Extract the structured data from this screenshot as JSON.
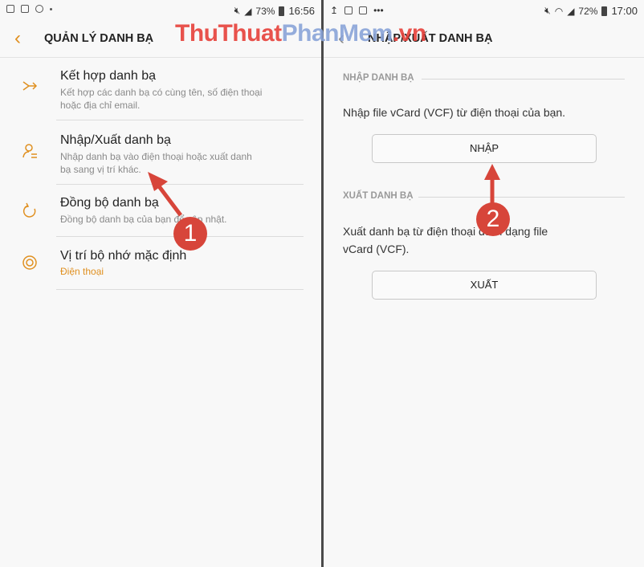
{
  "left_screen": {
    "status_bar": {
      "battery": "73%",
      "time": "16:56"
    },
    "app_bar": {
      "title": "QUẢN LÝ DANH BẠ"
    },
    "items": [
      {
        "title": "Kết hợp danh bạ",
        "subtitle_1": "Kết hợp các danh bạ có cùng tên, số điện thoại",
        "subtitle_2": "hoặc địa chỉ email.",
        "icon": "merge-icon"
      },
      {
        "title": "Nhập/Xuất danh bạ",
        "subtitle_1": "Nhập danh bạ vào điện thoại hoặc xuất danh",
        "subtitle_2": "bạ sang vị trí khác.",
        "icon": "import-export-icon"
      },
      {
        "title": "Đồng bộ danh bạ",
        "subtitle_1": "Đồng bộ danh bạ của bạn để cập nhật.",
        "icon": "sync-icon"
      },
      {
        "title": "Vị trí bộ nhớ mặc định",
        "subtitle_1": "Điện thoại",
        "icon": "storage-icon"
      }
    ]
  },
  "right_screen": {
    "status_bar": {
      "battery": "72%",
      "time": "17:00"
    },
    "app_bar": {
      "title": "NHẬP/XUẤT DANH BẠ"
    },
    "import_section": {
      "header": "NHẬP DANH BẠ",
      "text": "Nhập file vCard (VCF) từ điện thoại của bạn.",
      "button": "NHẬP"
    },
    "export_section": {
      "header": "XUẤT DANH BẠ",
      "text_1": "Xuất danh bạ từ điện thoại dưới dạng file",
      "text_2": "vCard (VCF).",
      "button": "XUẤT"
    }
  },
  "annotations": {
    "step_1": "1",
    "step_2": "2"
  },
  "watermark": {
    "part_1": "ThuThuat",
    "part_2": "PhanMem",
    "part_3": ".vn"
  },
  "colors": {
    "accent": "#e09020",
    "annotation": "#d7453a",
    "watermark": "#e7413a"
  }
}
